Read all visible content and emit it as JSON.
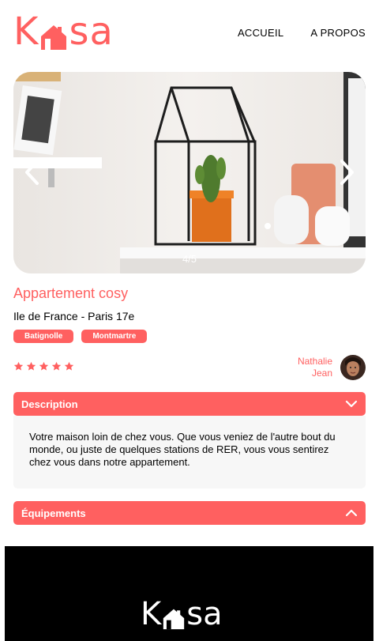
{
  "brand": {
    "logo_left": "K",
    "logo_right": "sa",
    "color": "#FF6060"
  },
  "nav": {
    "home": "ACCUEIL",
    "about": "A PROPOS"
  },
  "carousel": {
    "counter": "4/5",
    "prev_icon": "chevron-left-icon",
    "next_icon": "chevron-right-icon"
  },
  "listing": {
    "title": "Appartement cosy",
    "location": "Ile de France - Paris 17e",
    "tags": [
      "Batignolle",
      "Montmartre"
    ],
    "rating": 5,
    "rating_max": 5
  },
  "host": {
    "first_name": "Nathalie",
    "last_name": "Jean"
  },
  "description": {
    "label": "Description",
    "text": "Votre maison loin de chez vous. Que vous veniez de l'autre bout du monde, ou juste de quelques stations de RER, vous vous sentirez chez vous dans notre appartement.",
    "icon": "chevron-down-icon"
  },
  "equipment": {
    "label": "Équipements",
    "icon": "chevron-up-icon"
  },
  "footer": {
    "logo_left": "K",
    "logo_right": "sa"
  }
}
